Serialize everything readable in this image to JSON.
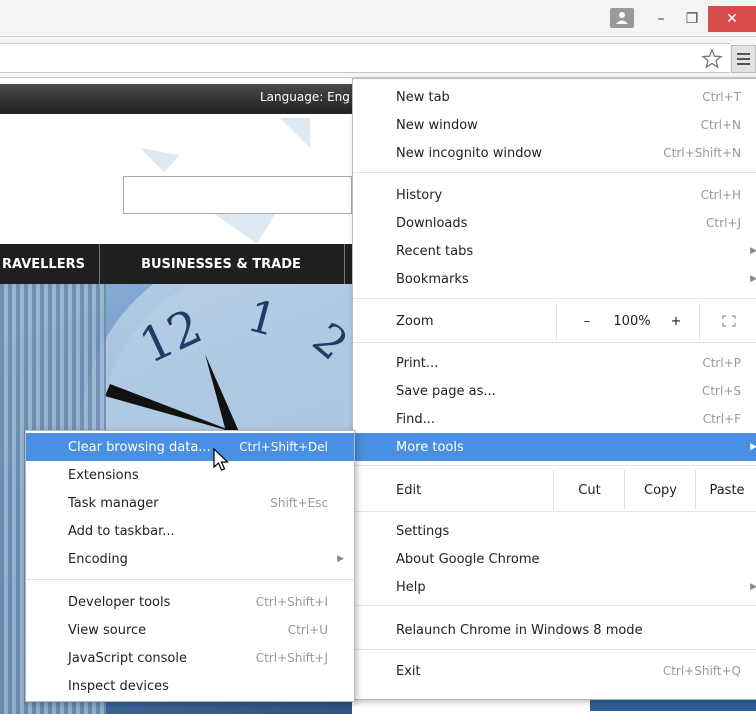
{
  "browser": {
    "window_controls": {
      "minimize": "–",
      "maximize": "❐",
      "close": "✕"
    },
    "user_icon": "user-icon",
    "star_icon": "star-icon",
    "menu_icon": "hamburger-menu-icon"
  },
  "page": {
    "language_label": "Language:",
    "language_value": "Eng",
    "nav": [
      "RAVELLERS",
      "BUSINESSES & TRADE"
    ]
  },
  "main_menu": {
    "items": [
      {
        "label": "New tab",
        "shortcut": "Ctrl+T"
      },
      {
        "label": "New window",
        "shortcut": "Ctrl+N"
      },
      {
        "label": "New incognito window",
        "shortcut": "Ctrl+Shift+N"
      },
      {
        "label": "History",
        "shortcut": "Ctrl+H"
      },
      {
        "label": "Downloads",
        "shortcut": "Ctrl+J"
      },
      {
        "label": "Recent tabs",
        "shortcut": ""
      },
      {
        "label": "Bookmarks",
        "shortcut": ""
      },
      {
        "label": "Print...",
        "shortcut": "Ctrl+P"
      },
      {
        "label": "Save page as...",
        "shortcut": "Ctrl+S"
      },
      {
        "label": "Find...",
        "shortcut": "Ctrl+F"
      },
      {
        "label": "More tools",
        "shortcut": ""
      },
      {
        "label": "Settings",
        "shortcut": ""
      },
      {
        "label": "About Google Chrome",
        "shortcut": ""
      },
      {
        "label": "Help",
        "shortcut": ""
      },
      {
        "label": "Relaunch Chrome in Windows 8 mode",
        "shortcut": ""
      },
      {
        "label": "Exit",
        "shortcut": "Ctrl+Shift+Q"
      }
    ],
    "zoom": {
      "label": "Zoom",
      "minus": "–",
      "value": "100%",
      "plus": "+",
      "fullscreen_icon": "fullscreen-icon"
    },
    "edit": {
      "label": "Edit",
      "cut": "Cut",
      "copy": "Copy",
      "paste": "Paste"
    }
  },
  "sub_menu": {
    "items": [
      {
        "label": "Clear browsing data...",
        "shortcut": "Ctrl+Shift+Del"
      },
      {
        "label": "Extensions",
        "shortcut": ""
      },
      {
        "label": "Task manager",
        "shortcut": "Shift+Esc"
      },
      {
        "label": "Add to taskbar...",
        "shortcut": ""
      },
      {
        "label": "Encoding",
        "shortcut": ""
      },
      {
        "label": "Developer tools",
        "shortcut": "Ctrl+Shift+I"
      },
      {
        "label": "View source",
        "shortcut": "Ctrl+U"
      },
      {
        "label": "JavaScript console",
        "shortcut": "Ctrl+Shift+J"
      },
      {
        "label": "Inspect devices",
        "shortcut": ""
      }
    ]
  },
  "colors": {
    "highlight": "#4a90e2",
    "close_button": "#d94c4c"
  }
}
